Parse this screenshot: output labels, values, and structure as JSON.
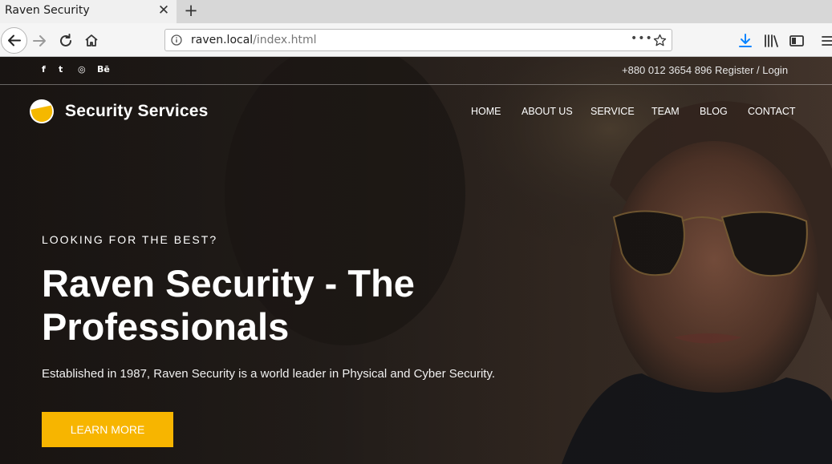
{
  "browser": {
    "tab_title": "Raven Security",
    "tab_close": "✕",
    "new_tab": "+",
    "url_host": "raven.local",
    "url_path": "/index.html",
    "url_more": "•••"
  },
  "topbar": {
    "social": [
      "f",
      "t",
      "◎",
      "Bē"
    ],
    "phone": "+880 012 3654 896",
    "auth": "Register / Login"
  },
  "brand": {
    "name": "Security Services"
  },
  "menu": [
    "HOME",
    "ABOUT US",
    "SERVICE",
    "TEAM",
    "BLOG",
    "CONTACT"
  ],
  "hero": {
    "kicker": "LOOKING FOR THE BEST?",
    "headline": "Raven Security - The Professionals",
    "subtext": "Established in 1987, Raven Security is a world leader in Physical and Cyber Security.",
    "cta": "LEARN MORE"
  },
  "colors": {
    "accent": "#f7b500",
    "download_blue": "#0a84ff"
  }
}
